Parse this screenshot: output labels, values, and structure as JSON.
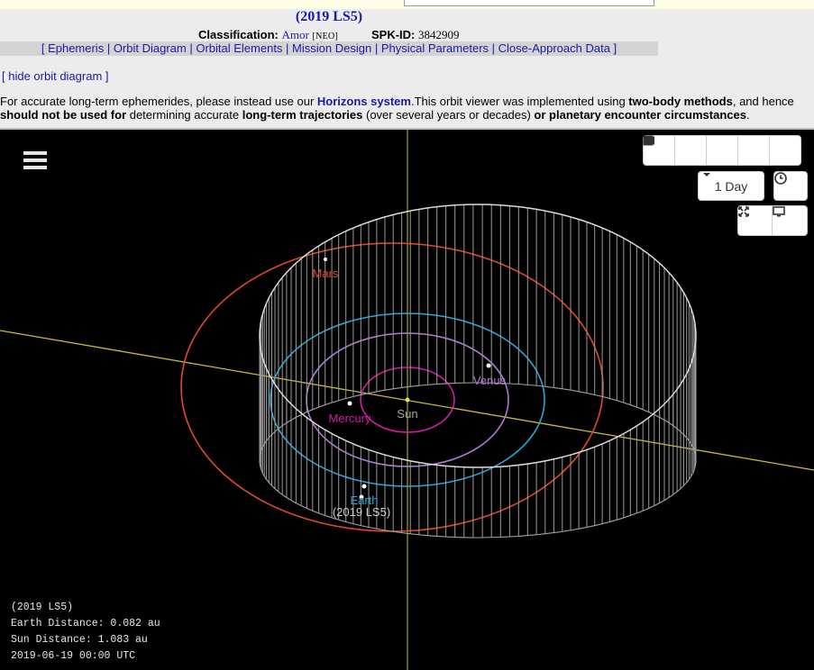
{
  "header": {
    "title": "(2019 LS5)",
    "classification_label": "Classification:",
    "classification_value": "Amor",
    "classification_tag": "[NEO]",
    "spk_label": "SPK-ID:",
    "spk_value": "3842909"
  },
  "nav": {
    "items": [
      "Ephemeris",
      "Orbit Diagram",
      "Orbital Elements",
      "Mission Design",
      "Physical Parameters",
      "Close-Approach Data"
    ]
  },
  "hide_link": "[ hide orbit diagram ]",
  "note": {
    "p1": "For accurate long-term ephemerides, please instead use our ",
    "horizons": "Horizons system",
    "p2": ".This orbit viewer was implemented using ",
    "b1": "two-body methods",
    "p3": ", and hence ",
    "b2": "should not be used for",
    "p4": " determining accurate ",
    "b3": "long-term trajectories",
    "p5": " (over several years or decades) ",
    "b4": "or planetary encounter circumstances",
    "p6": "."
  },
  "viewer": {
    "step_select": "1 Day",
    "labels": {
      "sun": "Sun",
      "mercury": "Mercury",
      "venus": "Venus",
      "earth": "Earth",
      "mars": "Mars",
      "object": "(2019 LS5)"
    },
    "colors": {
      "mercury": "#d21ba6",
      "venus": "#b07bd0",
      "earth": "#2aa6d8",
      "mars": "#e2492c",
      "object": "#e6e6e6",
      "axis": "#c7bb38"
    },
    "info": {
      "name": "(2019 LS5)",
      "earth_distance": "Earth Distance: 0.082 au",
      "sun_distance": "Sun Distance: 1.083 au",
      "datetime": "2019-06-19 00:00 UTC"
    }
  }
}
